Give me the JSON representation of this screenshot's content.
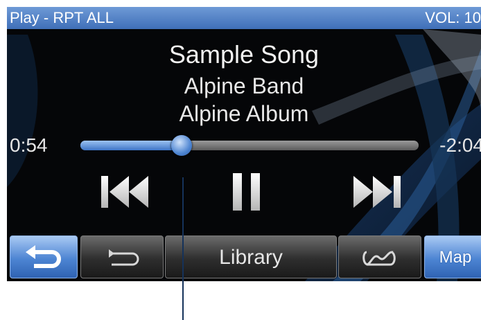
{
  "status_bar": {
    "mode": "Play - RPT ALL",
    "volume": "VOL: 10"
  },
  "track": {
    "title": "Sample Song",
    "artist": "Alpine Band",
    "album": "Alpine Album"
  },
  "playback": {
    "elapsed": "0:54",
    "remaining": "-2:04",
    "progress_fraction": 0.3
  },
  "controls": {
    "previous": "previous-track-icon",
    "pause": "pause-icon",
    "next": "next-track-icon"
  },
  "bottom_bar": {
    "back_icon": "back-arrow-icon",
    "repeat_icon": "repeat-icon",
    "library_label": "Library",
    "shuffle_icon": "shuffle-icon",
    "map_label": "Map"
  },
  "colors": {
    "accent_blue": "#3f6fb8",
    "screen_bg": "#050608"
  }
}
